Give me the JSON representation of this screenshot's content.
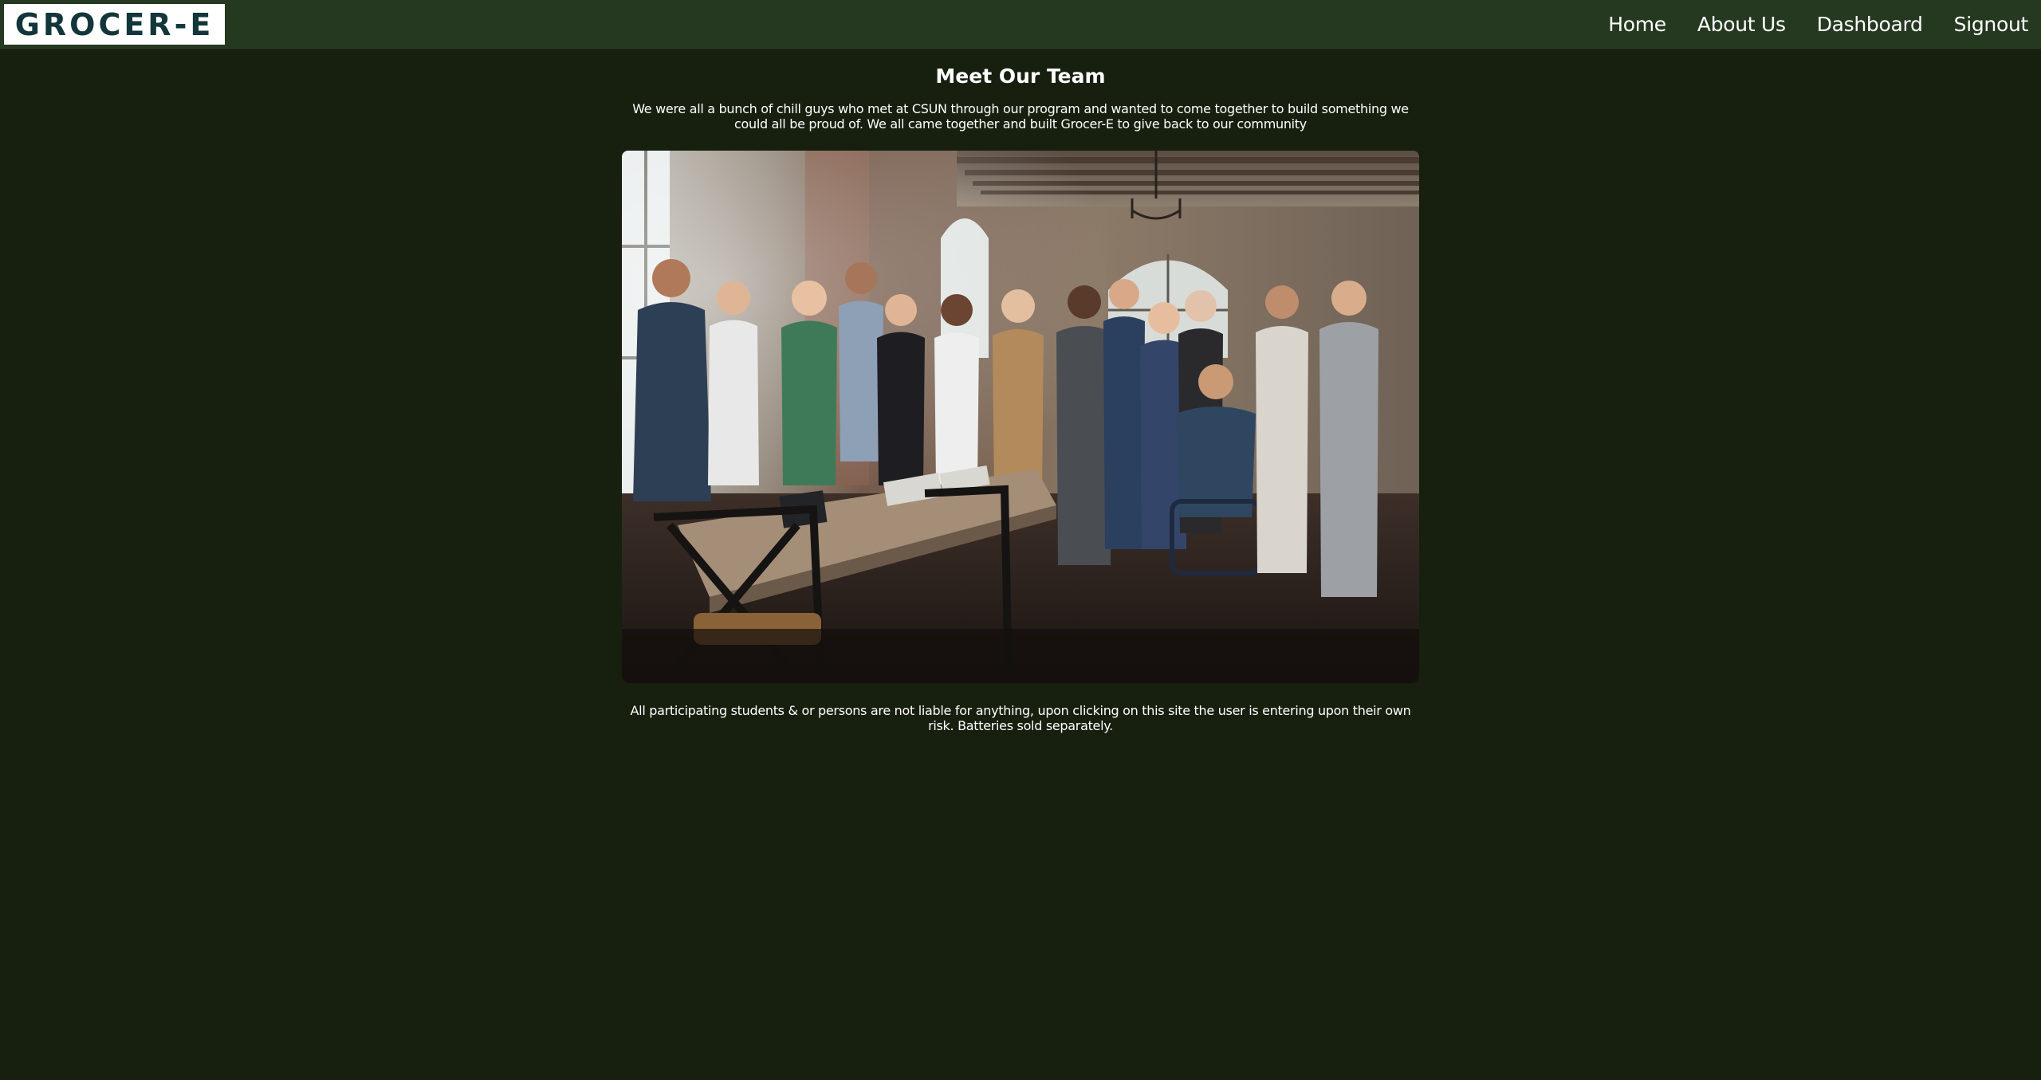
{
  "header": {
    "logo_text": "GROCER-E",
    "nav": [
      {
        "label": "Home"
      },
      {
        "label": "About Us"
      },
      {
        "label": "Dashboard"
      },
      {
        "label": "Signout"
      }
    ]
  },
  "main": {
    "title": "Meet Our Team",
    "intro": "We were all a bunch of chill guys who met at CSUN through our program and wanted to come together to build something we could all be proud of. We all came together and built Grocer-E to give back to our community",
    "disclaimer": "All participating students & or persons are not liable for anything, upon clicking on this site the user is entering upon their own risk. Batteries sold separately."
  },
  "colors": {
    "page_background": "#17200f",
    "navbar_background": "#253820",
    "logo_text": "#12363a"
  }
}
